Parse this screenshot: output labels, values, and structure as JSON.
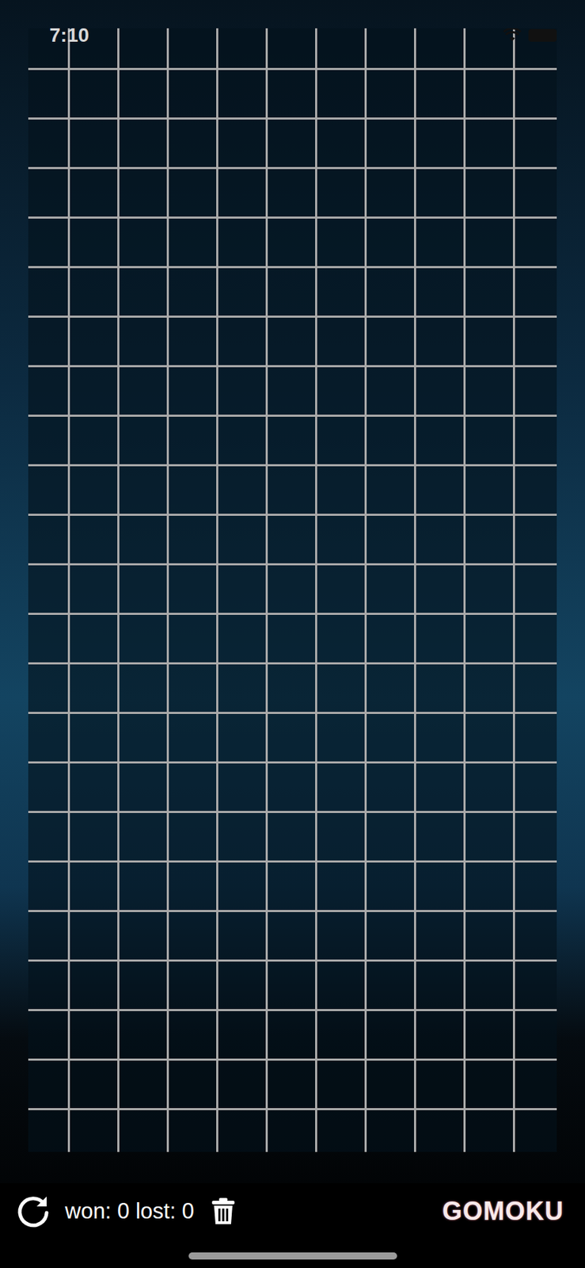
{
  "status_bar": {
    "time": "7:10"
  },
  "board": {
    "columns": 11,
    "rows": 23,
    "stones": []
  },
  "score": {
    "won_label": "won:",
    "won": "0",
    "lost_label": "lost:",
    "lost": "0"
  },
  "logo": "GOMOKU"
}
